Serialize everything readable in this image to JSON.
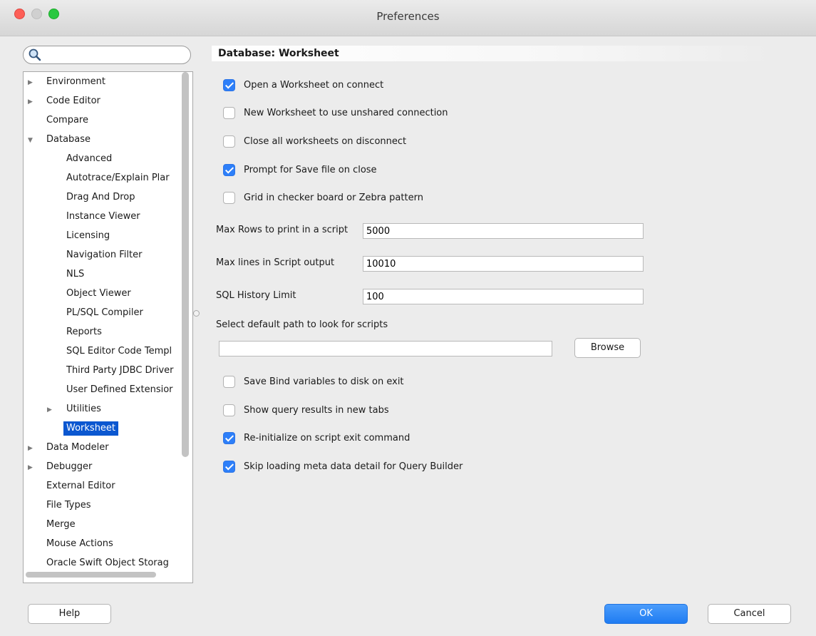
{
  "window": {
    "title": "Preferences"
  },
  "search": {
    "value": ""
  },
  "tree": {
    "items": [
      {
        "label": "Environment",
        "expander": "collapsed"
      },
      {
        "label": "Code Editor",
        "expander": "collapsed"
      },
      {
        "label": "Compare",
        "expander": "none"
      },
      {
        "label": "Database",
        "expander": "expanded"
      },
      {
        "label": "Advanced",
        "expander": "none"
      },
      {
        "label": "Autotrace/Explain Plar",
        "expander": "none"
      },
      {
        "label": "Drag And Drop",
        "expander": "none"
      },
      {
        "label": "Instance Viewer",
        "expander": "none"
      },
      {
        "label": "Licensing",
        "expander": "none"
      },
      {
        "label": "Navigation Filter",
        "expander": "none"
      },
      {
        "label": "NLS",
        "expander": "none"
      },
      {
        "label": "Object Viewer",
        "expander": "none"
      },
      {
        "label": "PL/SQL Compiler",
        "expander": "none"
      },
      {
        "label": "Reports",
        "expander": "none"
      },
      {
        "label": "SQL Editor Code Templ",
        "expander": "none"
      },
      {
        "label": "Third Party JDBC Driver",
        "expander": "none"
      },
      {
        "label": "User Defined Extensior",
        "expander": "none"
      },
      {
        "label": "Utilities",
        "expander": "collapsed"
      },
      {
        "label": "Worksheet",
        "expander": "none",
        "selected": true
      },
      {
        "label": "Data Modeler",
        "expander": "collapsed"
      },
      {
        "label": "Debugger",
        "expander": "collapsed"
      },
      {
        "label": "External Editor",
        "expander": "none"
      },
      {
        "label": "File Types",
        "expander": "none"
      },
      {
        "label": "Merge",
        "expander": "none"
      },
      {
        "label": "Mouse Actions",
        "expander": "none"
      },
      {
        "label": "Oracle Swift Object Storag",
        "expander": "none"
      }
    ]
  },
  "panel": {
    "title": "Database: Worksheet",
    "checkboxes_top": [
      {
        "label": "Open a Worksheet on connect",
        "checked": true
      },
      {
        "label": "New Worksheet to use unshared connection",
        "checked": false
      },
      {
        "label": "Close all worksheets on disconnect",
        "checked": false
      },
      {
        "label": "Prompt for Save file on close",
        "checked": true
      },
      {
        "label": "Grid in checker board or Zebra pattern",
        "checked": false
      }
    ],
    "fields": [
      {
        "label": "Max Rows to print in a script",
        "value": "5000"
      },
      {
        "label": "Max lines in Script output",
        "value": "10010"
      },
      {
        "label": "SQL History Limit",
        "value": "100"
      }
    ],
    "path_label": "Select default path to look for scripts",
    "path_value": "",
    "browse_label": "Browse",
    "checkboxes_bottom": [
      {
        "label": "Save Bind variables to disk on exit",
        "checked": false
      },
      {
        "label": "Show query results in new tabs",
        "checked": false
      },
      {
        "label": "Re-initialize on script exit command",
        "checked": true
      },
      {
        "label": "Skip loading meta data detail for Query Builder",
        "checked": true
      }
    ]
  },
  "footer": {
    "help_label": "Help",
    "ok_label": "OK",
    "cancel_label": "Cancel"
  },
  "colors": {
    "accent": "#2d7ff9",
    "selection": "#0b57d0",
    "window_bg": "#ececec"
  }
}
